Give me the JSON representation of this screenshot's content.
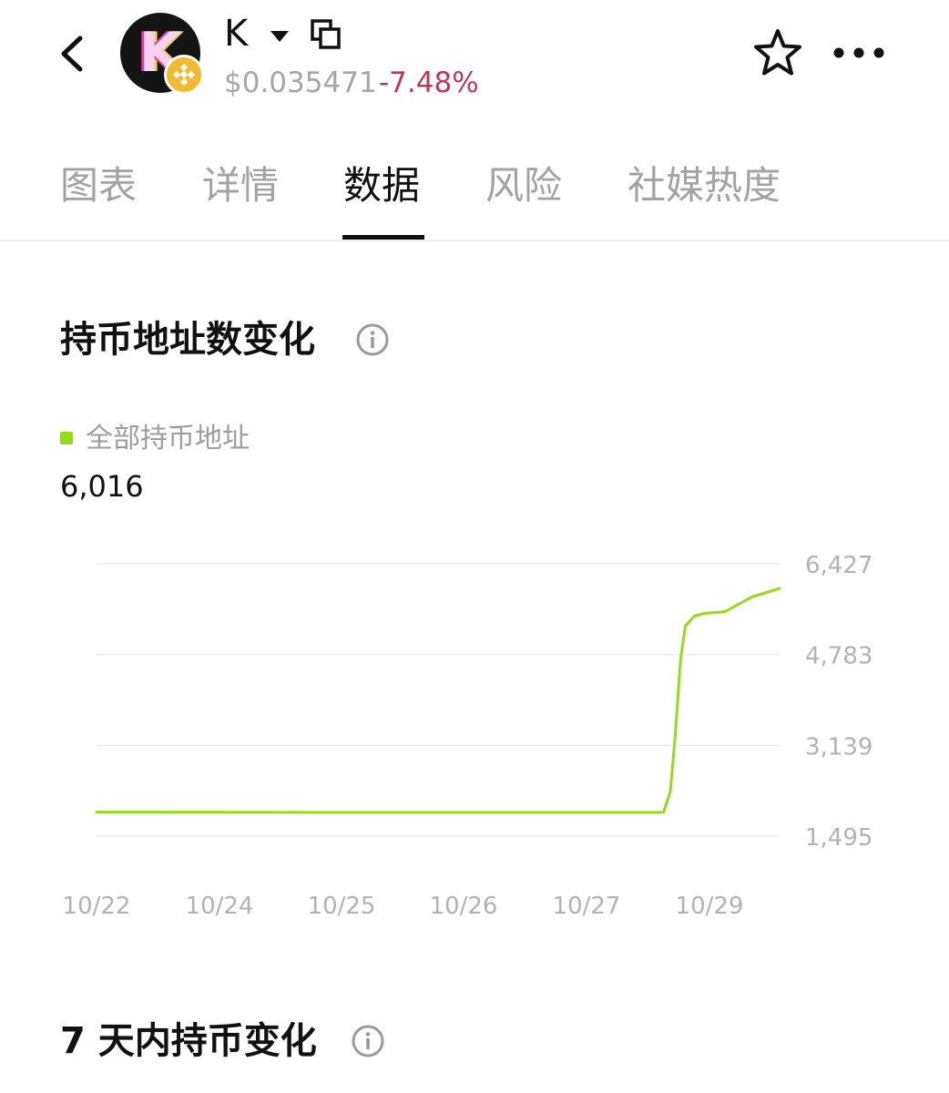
{
  "header": {
    "back_icon": "chevron-left-icon",
    "avatar_letter": "K",
    "chain_badge_icon": "bnb-chain-icon",
    "token_name": "K",
    "price": "$0.035471",
    "change": "-7.48%",
    "change_color": "#c0375e",
    "star_icon": "star-outline-icon",
    "more_icon": "more-horizontal-icon"
  },
  "tabs": [
    {
      "label": "图表",
      "active": false
    },
    {
      "label": "详情",
      "active": false
    },
    {
      "label": "数据",
      "active": true
    },
    {
      "label": "风险",
      "active": false
    },
    {
      "label": "社媒热度",
      "active": false
    }
  ],
  "holders_section": {
    "title": "持币地址数变化",
    "info_icon": "info-circle-icon",
    "legend_label": "全部持币地址",
    "legend_color": "#93db1b",
    "current_value": "6,016"
  },
  "chart_data": {
    "type": "line",
    "title": "",
    "xlabel": "",
    "ylabel": "",
    "y_ticks": [
      "6,427",
      "4,783",
      "3,139",
      "1,495"
    ],
    "y_tick_values": [
      6427,
      4783,
      3139,
      1495
    ],
    "ylim": [
      1495,
      6427
    ],
    "x_tick_labels": [
      "10/22",
      "10/24",
      "10/25",
      "10/26",
      "10/27",
      "10/29"
    ],
    "grid": true,
    "series": [
      {
        "color": "#93db1b",
        "points": [
          [
            0,
            1930
          ],
          [
            0.1,
            1930
          ],
          [
            0.2,
            1928
          ],
          [
            0.3,
            1926
          ],
          [
            0.4,
            1925
          ],
          [
            0.5,
            1925
          ],
          [
            0.6,
            1925
          ],
          [
            0.7,
            1925
          ],
          [
            0.83,
            1925
          ],
          [
            0.84,
            2300
          ],
          [
            0.847,
            3300
          ],
          [
            0.855,
            4700
          ],
          [
            0.862,
            5300
          ],
          [
            0.875,
            5480
          ],
          [
            0.89,
            5530
          ],
          [
            0.92,
            5560
          ],
          [
            0.96,
            5830
          ],
          [
            1.0,
            5980
          ]
        ]
      }
    ]
  },
  "holders_7d_section": {
    "title": "7 天内持币变化",
    "info_icon": "info-circle-icon"
  }
}
